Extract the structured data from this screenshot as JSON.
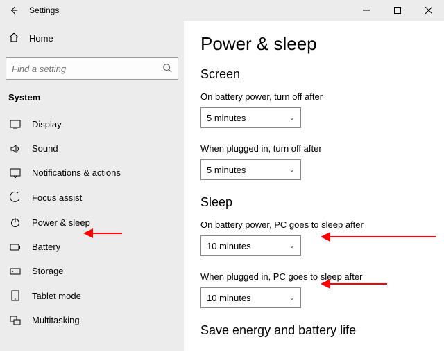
{
  "titlebar": {
    "title": "Settings"
  },
  "sidebar": {
    "home_label": "Home",
    "search_placeholder": "Find a setting",
    "category": "System",
    "items": [
      {
        "label": "Display"
      },
      {
        "label": "Sound"
      },
      {
        "label": "Notifications & actions"
      },
      {
        "label": "Focus assist"
      },
      {
        "label": "Power & sleep"
      },
      {
        "label": "Battery"
      },
      {
        "label": "Storage"
      },
      {
        "label": "Tablet mode"
      },
      {
        "label": "Multitasking"
      }
    ]
  },
  "content": {
    "page_title": "Power & sleep",
    "screen": {
      "heading": "Screen",
      "battery_label": "On battery power, turn off after",
      "battery_value": "5 minutes",
      "plugged_label": "When plugged in, turn off after",
      "plugged_value": "5 minutes"
    },
    "sleep": {
      "heading": "Sleep",
      "battery_label": "On battery power, PC goes to sleep after",
      "battery_value": "10 minutes",
      "plugged_label": "When plugged in, PC goes to sleep after",
      "plugged_value": "10 minutes"
    },
    "save_heading": "Save energy and battery life"
  },
  "annotations": {
    "color": "#ff0000"
  }
}
